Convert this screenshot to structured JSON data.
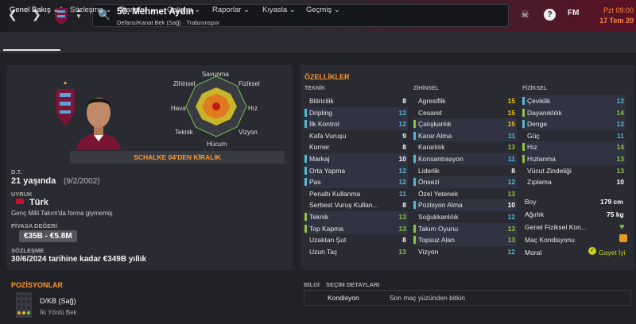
{
  "header": {
    "title": "50. Mehmet Aydın",
    "subtitle": "Defans/Kanat Bek (Sağ) · Trabzonspor",
    "date_line1": "Pzt 09:00",
    "date_line2": "17 Tem 20",
    "fm_label": "FM"
  },
  "nav": {
    "tabs": [
      "Genel Bakış ⌄",
      "Sözleşme ⌄",
      "Transfer ⌄",
      "Gelişim ⌄",
      "Raporlar ⌄",
      "Kıyasla ⌄",
      "Geçmiş ⌄"
    ]
  },
  "radar": {
    "labels": {
      "top": "Savunma",
      "tr": "Fiziksel",
      "r": "Hız",
      "br": "Vizyon",
      "bottom": "Hücum",
      "bl": "Teknik",
      "l": "Hava",
      "tl": "Zihinsel"
    }
  },
  "loan": "SCHALKE 04'DEN KİRALIK",
  "profile": {
    "dt_label": "D.T.",
    "age": "21 yaşında",
    "dob": "(9/2/2002)",
    "nat_label": "UYRUK",
    "nationality": "Türk",
    "intl": "Genç Milli Takım'da forma giymemiş",
    "value_label": "PİYASA DEĞERİ",
    "value": "€35B - €5.8M",
    "contract_label": "SÖZLEŞME",
    "contract": "30/6/2024 tarihine kadar €349B yıllık"
  },
  "attributes": {
    "title": "ÖZELLİKLER",
    "technical": {
      "head": "TEKNİK",
      "rows": [
        {
          "n": "Bitiricilik",
          "v": "8",
          "hl": false
        },
        {
          "n": "Dripling",
          "v": "12",
          "hl": true
        },
        {
          "n": "İlk Kontrol",
          "v": "12",
          "hl": true
        },
        {
          "n": "Kafa Vuruşu",
          "v": "9",
          "hl": false
        },
        {
          "n": "Korner",
          "v": "8",
          "hl": false
        },
        {
          "n": "Markaj",
          "v": "10",
          "hl": true
        },
        {
          "n": "Orta Yapma",
          "v": "12",
          "hl": true
        },
        {
          "n": "Pas",
          "v": "12",
          "hl": true
        },
        {
          "n": "Penaltı Kullanma",
          "v": "11",
          "hl": false
        },
        {
          "n": "Serbest Vuruş Kullan...",
          "v": "8",
          "hl": false
        },
        {
          "n": "Teknik",
          "v": "13",
          "hl": true
        },
        {
          "n": "Top Kapma",
          "v": "13",
          "hl": true
        },
        {
          "n": "Uzaktan Şut",
          "v": "8",
          "hl": false
        },
        {
          "n": "Uzun Taç",
          "v": "13",
          "hl": false
        }
      ]
    },
    "mental": {
      "head": "ZİHİNSEL",
      "rows": [
        {
          "n": "Agresiflik",
          "v": "15",
          "hl": false
        },
        {
          "n": "Cesaret",
          "v": "15",
          "hl": false
        },
        {
          "n": "Çalışkanlık",
          "v": "15",
          "hl": true
        },
        {
          "n": "Karar Alma",
          "v": "11",
          "hl": true
        },
        {
          "n": "Kararlılık",
          "v": "13",
          "hl": false
        },
        {
          "n": "Konsantrasyon",
          "v": "11",
          "hl": true
        },
        {
          "n": "Liderlik",
          "v": "8",
          "hl": false
        },
        {
          "n": "Önsezi",
          "v": "12",
          "hl": true
        },
        {
          "n": "Özel Yetenek",
          "v": "13",
          "hl": false
        },
        {
          "n": "Pozisyon Alma",
          "v": "10",
          "hl": true
        },
        {
          "n": "Soğukkanlılık",
          "v": "12",
          "hl": false
        },
        {
          "n": "Takım Oyunu",
          "v": "13",
          "hl": true
        },
        {
          "n": "Topsuz Alan",
          "v": "13",
          "hl": true
        },
        {
          "n": "Vizyon",
          "v": "12",
          "hl": false
        }
      ]
    },
    "physical": {
      "head": "FİZİKSEL",
      "rows": [
        {
          "n": "Çeviklik",
          "v": "12",
          "hl": true
        },
        {
          "n": "Dayanıklılık",
          "v": "14",
          "hl": true
        },
        {
          "n": "Denge",
          "v": "12",
          "hl": true
        },
        {
          "n": "Güç",
          "v": "11",
          "hl": false
        },
        {
          "n": "Hız",
          "v": "14",
          "hl": true
        },
        {
          "n": "Hızlanma",
          "v": "13",
          "hl": true
        },
        {
          "n": "Vücut Zindeliği",
          "v": "13",
          "hl": false
        },
        {
          "n": "Zıplama",
          "v": "10",
          "hl": false
        }
      ]
    }
  },
  "physinfo": {
    "boy_label": "Boy",
    "boy": "179 cm",
    "agirlik_label": "Ağırlık",
    "agirlik": "75 kg",
    "fitness_label": "Genel Fiziksel Kon...",
    "kondisyon_label": "Maç Kondisyonu",
    "moral_label": "Moral",
    "moral": "Gayet İyi"
  },
  "positions": {
    "title": "POZİSYONLAR",
    "pos": "D/KB (Sağ)",
    "role": "İki Yönlü Bek"
  },
  "bilgi": {
    "label": "BİLGİ",
    "sec_label": "SEÇİM DETAYLARI",
    "key": "Kondisyon",
    "value": "Son maç yüzünden bitkin"
  },
  "colors": {
    "accent": "#ff9a2e",
    "strong": "#f2c400",
    "good": "#8ec63f",
    "mid": "#55b9d4",
    "bar_hi": "#8ec63f",
    "bar_mid": "#55b9d4"
  }
}
